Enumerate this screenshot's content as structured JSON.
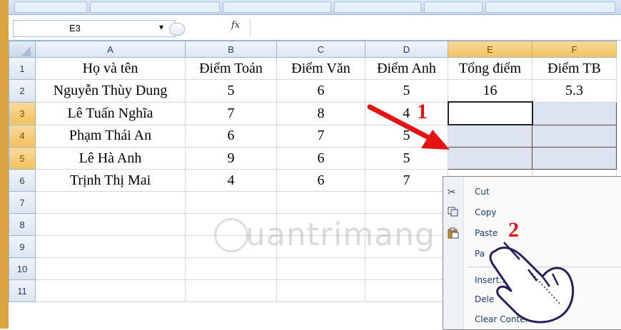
{
  "formula_bar": {
    "name_box": "E3",
    "dropdown_glyph": "▾",
    "fx_label": "fx",
    "formula": ""
  },
  "columns": [
    "A",
    "B",
    "C",
    "D",
    "E",
    "F"
  ],
  "selected_columns": [
    "E",
    "F"
  ],
  "row_numbers": [
    "1",
    "2",
    "3",
    "4",
    "5",
    "6",
    "7",
    "8",
    "9",
    "10",
    "11"
  ],
  "selected_rows": [
    "3",
    "4",
    "5"
  ],
  "sheet": {
    "headers": [
      "Họ và tên",
      "Điểm Toán",
      "Điểm Văn",
      "Điểm Anh",
      "Tổng điểm",
      "Điểm TB"
    ],
    "rows": [
      [
        "Nguyễn Thùy Dung",
        "5",
        "6",
        "5",
        "16",
        "5.3"
      ],
      [
        "Lê Tuấn Nghĩa",
        "7",
        "8",
        "4",
        "",
        ""
      ],
      [
        "Phạm Thái An",
        "6",
        "7",
        "5",
        "",
        ""
      ],
      [
        "Lê Hà Anh",
        "9",
        "6",
        "5",
        "",
        ""
      ],
      [
        "Trịnh Thị Mai",
        "4",
        "6",
        "7",
        "",
        ""
      ]
    ]
  },
  "context_menu": {
    "items": [
      {
        "label": "Cut",
        "icon": "scissors-icon"
      },
      {
        "label": "Copy",
        "icon": "copy-icon"
      },
      {
        "label": "Paste",
        "icon": "paste-icon"
      },
      {
        "label": "Pa",
        "icon": ""
      },
      {
        "label": "Insert...",
        "icon": ""
      },
      {
        "label": "Dele",
        "icon": ""
      },
      {
        "label": "Clear Contents",
        "icon": ""
      }
    ]
  },
  "annotations": {
    "step1": "1",
    "step2": "2"
  },
  "watermark": "uantrimang",
  "colors": {
    "selection_header": "#f1c15f",
    "annotation": "#e21414",
    "header_text": "#1f3c66"
  }
}
